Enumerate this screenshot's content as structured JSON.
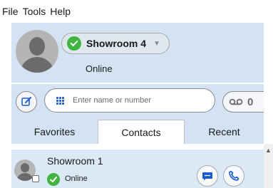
{
  "menu": {
    "items": [
      "File",
      "Tools",
      "Help"
    ]
  },
  "profile": {
    "account_name": "Showroom 4",
    "status": "Online",
    "status_color": "#3fb53f"
  },
  "search": {
    "placeholder": "Enter name or number"
  },
  "voicemail": {
    "count": "0"
  },
  "tabs": [
    {
      "label": "Favorites",
      "active": false
    },
    {
      "label": "Contacts",
      "active": true
    },
    {
      "label": "Recent",
      "active": false
    }
  ],
  "contacts": [
    {
      "name": "Showroom 1",
      "status": "Online"
    }
  ],
  "colors": {
    "accent": "#1a5ccc",
    "header_bg": "#d3e3f3",
    "selected_row": "#dbe8f6"
  },
  "icons": [
    "compose-icon",
    "dialpad-icon",
    "voicemail-icon",
    "chat-icon",
    "phone-icon",
    "check-icon",
    "scroll-up-icon"
  ]
}
